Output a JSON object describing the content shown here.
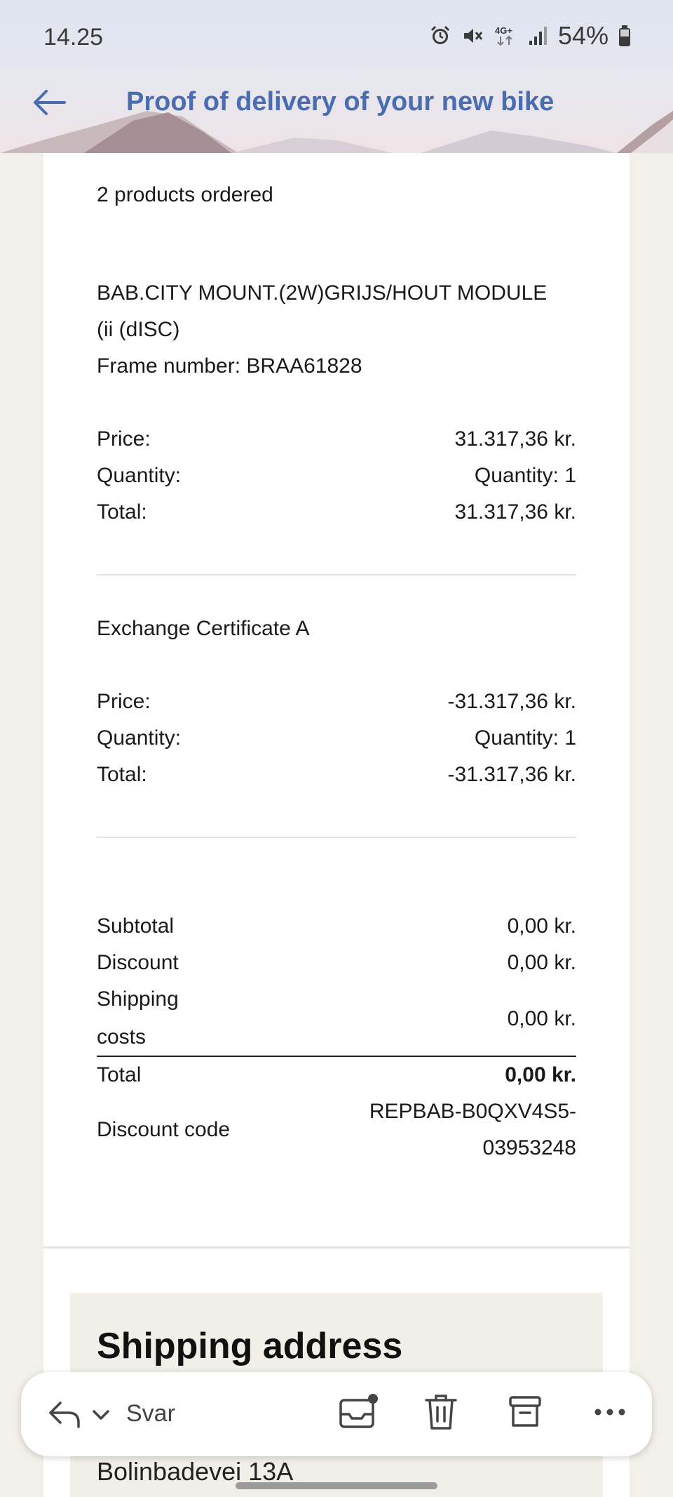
{
  "status_bar": {
    "time": "14.25",
    "network": "4G+",
    "battery": "54%",
    "icons": [
      "alarm-icon",
      "mute-icon",
      "network-4g-icon",
      "signal-icon",
      "battery-icon"
    ]
  },
  "header": {
    "title": "Proof of delivery of your new bike",
    "back_icon": "back-arrow-icon"
  },
  "order": {
    "count_text": "2 products ordered",
    "items": [
      {
        "name_line1": "BAB.CITY MOUNT.(2W)GRIJS/HOUT MODULE",
        "name_line2": "(ii (dISC)",
        "frame": "Frame number: BRAA61828",
        "price_label": "Price:",
        "price": "31.317,36 kr.",
        "quantity_label": "Quantity:",
        "quantity": "Quantity: 1",
        "total_label": "Total:",
        "total": "31.317,36 kr."
      },
      {
        "name_line1": "Exchange Certificate A",
        "price_label": "Price:",
        "price": "-31.317,36 kr.",
        "quantity_label": "Quantity:",
        "quantity": "Quantity: 1",
        "total_label": "Total:",
        "total": "-31.317,36 kr."
      }
    ]
  },
  "summary": {
    "subtotal_label": "Subtotal",
    "subtotal": "0,00 kr.",
    "discount_label": "Discount",
    "discount": "0,00 kr.",
    "shipping_label_1": "Shipping",
    "shipping_label_2": "costs",
    "shipping": "0,00 kr.",
    "total_label": "Total",
    "total": "0,00 kr.",
    "discount_code_label": "Discount code",
    "discount_code_1": "REPBAB-B0QXV4S5-",
    "discount_code_2": "03953248"
  },
  "shipping_address": {
    "title": "Shipping address",
    "line1_partial": "Bolinbadevei 13A"
  },
  "actions": {
    "reply_label": "Svar",
    "icons": [
      "reply-icon",
      "chevron-down-icon",
      "mark-unread-icon",
      "delete-icon",
      "archive-icon",
      "more-icon"
    ]
  },
  "colors": {
    "title": "#4a6cb0",
    "background": "#f3efea",
    "card": "#ffffff"
  }
}
